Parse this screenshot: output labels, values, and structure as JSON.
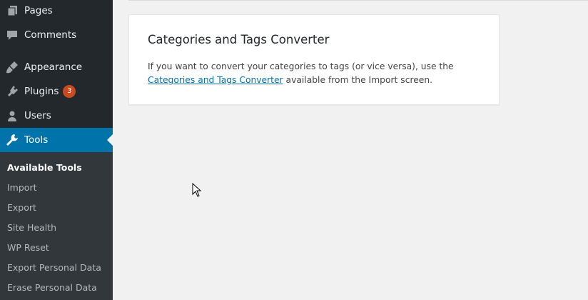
{
  "sidebar": {
    "items": [
      {
        "label": "Pages",
        "icon": "pages-icon"
      },
      {
        "label": "Comments",
        "icon": "comments-icon"
      },
      {
        "label": "Appearance",
        "icon": "appearance-icon"
      },
      {
        "label": "Plugins",
        "icon": "plugins-icon",
        "badge": "3"
      },
      {
        "label": "Users",
        "icon": "users-icon"
      },
      {
        "label": "Tools",
        "icon": "tools-icon",
        "active": true
      }
    ],
    "submenu": [
      {
        "label": "Available Tools",
        "current": true
      },
      {
        "label": "Import"
      },
      {
        "label": "Export"
      },
      {
        "label": "Site Health"
      },
      {
        "label": "WP Reset"
      },
      {
        "label": "Export Personal Data"
      },
      {
        "label": "Erase Personal Data"
      }
    ]
  },
  "card": {
    "title": "Categories and Tags Converter",
    "text_before": "If you want to convert your categories to tags (or vice versa), use the ",
    "link_text": "Categories and Tags Converter",
    "text_after": " available from the Import screen."
  },
  "colors": {
    "sidebar_bg": "#23282d",
    "submenu_bg": "#32373c",
    "active_bg": "#0073aa",
    "badge_bg": "#ca4a1f",
    "link": "#0073aa"
  }
}
